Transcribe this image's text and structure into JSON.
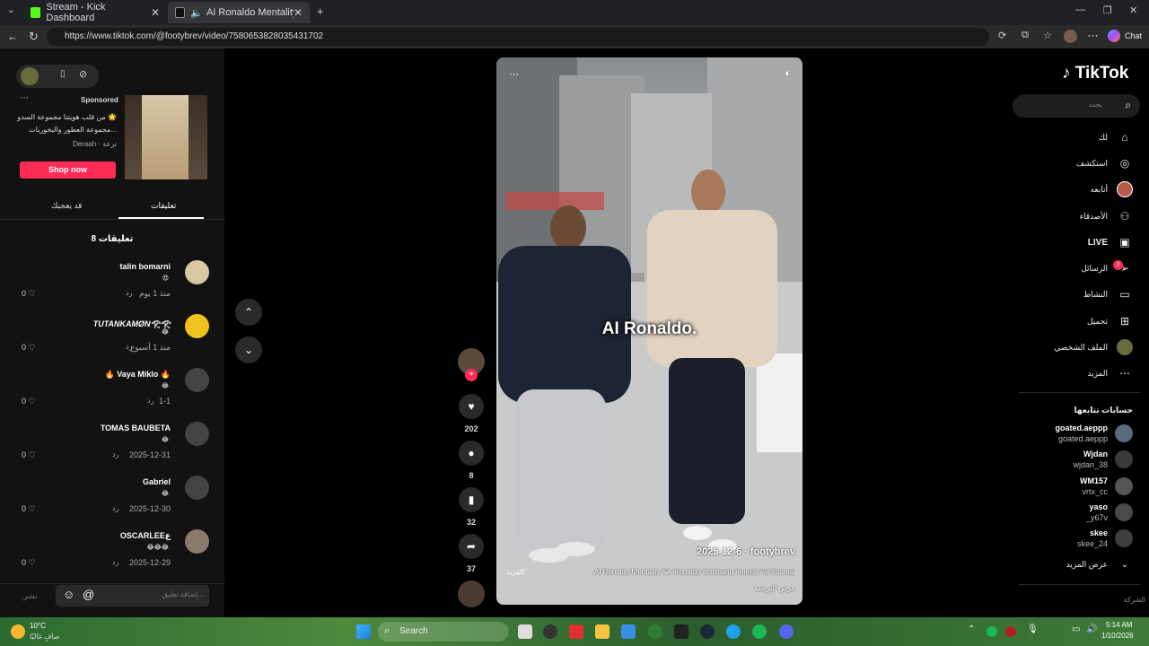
{
  "browser": {
    "tabs": [
      {
        "title": "Stream - Kick Dashboard"
      },
      {
        "title": "AI Ronaldo Mentality: Who's t"
      }
    ],
    "url": "https://www.tiktok.com/@footybrev/video/7580653828035431702",
    "profile_label": "Chat"
  },
  "left_panel": {
    "sponsored_label": "Sponsored",
    "ad_text_1": "من قلب هويتنا مجموعة السدو 🌟",
    "ad_text_2": "مجموعة العطور والبخوريات...",
    "ad_brand": "Deraah · ترعة",
    "shop_button": "Shop now",
    "tabs": {
      "liked": "قد يعجبك",
      "comments": "تعليقات"
    },
    "comments_count": "8 تعليقات",
    "comments": [
      {
        "name": "talin bomarni",
        "emoji": "😍",
        "date": "منذ 1 يوم",
        "reply": "رد",
        "likes": "0"
      },
      {
        "name": "TUTANKAMØN𓂀𓂀",
        "emoji": "😂",
        "date": "منذ 1 أسبوع",
        "reply": "رد",
        "likes": "0"
      },
      {
        "name": "🔥 Vaya Miklo 🔥",
        "emoji": "😂",
        "date": "1-1",
        "reply": "رد",
        "likes": "0"
      },
      {
        "name": "TOMAS BAUBETA",
        "emoji": "😂",
        "date": "2025-12-31",
        "reply": "رد",
        "likes": "0"
      },
      {
        "name": "Gabriel",
        "emoji": "😂",
        "date": "2025-12-30",
        "reply": "رد",
        "likes": "0"
      },
      {
        "name": "OSCARLEEع",
        "emoji": "😂😂😂",
        "date": "2025-12-29",
        "reply": "رد",
        "likes": "0"
      }
    ],
    "input_placeholder": "إضافة تعليق...",
    "post_label": "نشر"
  },
  "video": {
    "caption_overlay": "AI Ronaldo.",
    "author_date": "2025-12-6 · footybrev",
    "description": "AI Ronaldo Mentality 😂 #ronaldo #cristiano #messi #ai #soraai",
    "more_label": "المزيد",
    "translate_label": "عرض الترجمة",
    "likes": "202",
    "comments": "8",
    "saves": "32",
    "shares": "37"
  },
  "right_nav": {
    "logo": "TikTok",
    "search_placeholder": "بحث",
    "items": [
      {
        "label": "لك",
        "icon": "home-icon"
      },
      {
        "label": "استكشف",
        "icon": "compass-icon"
      },
      {
        "label": "أتابعه",
        "icon": "avatar-icon"
      },
      {
        "label": "الأصدقاء",
        "icon": "friends-icon"
      },
      {
        "label": "LIVE",
        "icon": "live-icon"
      },
      {
        "label": "الرسائل",
        "icon": "messages-icon"
      },
      {
        "label": "النشاط",
        "icon": "activity-icon"
      },
      {
        "label": "تحميل",
        "icon": "upload-icon"
      },
      {
        "label": "الملف الشخصي",
        "icon": "profile-icon"
      },
      {
        "label": "المزيد",
        "icon": "more-icon"
      }
    ],
    "messages_badge": "2",
    "following_title": "حسابات تتابعها",
    "following": [
      {
        "name": "goated.aeppp",
        "handle": "goated.aeppp"
      },
      {
        "name": "Wjdan",
        "handle": "wjdan_38"
      },
      {
        "name": "WM157",
        "handle": "vrtx_cc"
      },
      {
        "name": "yaso",
        "handle": "_y67v"
      },
      {
        "name": "skee",
        "handle": "skee_24"
      }
    ],
    "show_more": "عرض المزيد",
    "company": "الشركة"
  },
  "taskbar": {
    "weather_temp": "10°C",
    "weather_desc": "صافٍ غالبًا",
    "search_label": "Search",
    "time": "5:14 AM",
    "date": "1/10/2026"
  }
}
